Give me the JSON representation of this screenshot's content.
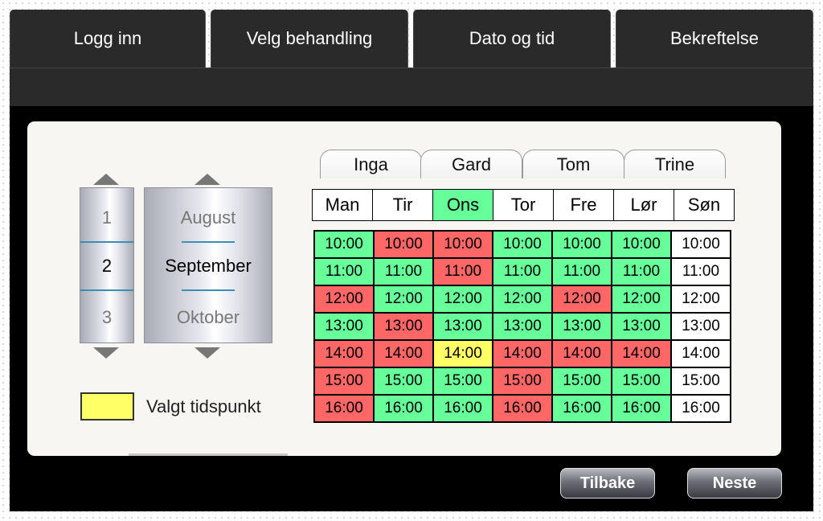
{
  "top_tabs": [
    "Logg inn",
    "Velg behandling",
    "Dato og tid",
    "Bekreftelse"
  ],
  "day_spinner": {
    "prev": "1",
    "current": "2",
    "next": "3"
  },
  "month_spinner": {
    "prev": "August",
    "current": "September",
    "next": "Oktober"
  },
  "legend": {
    "label": "Valgt tidspunkt",
    "color": "#ffff66"
  },
  "staff_tabs": [
    "Inga",
    "Gard",
    "Tom",
    "Trine"
  ],
  "days": [
    "Man",
    "Tir",
    "Ons",
    "Tor",
    "Fre",
    "Lør",
    "Søn"
  ],
  "active_day": 2,
  "times": [
    "10:00",
    "11:00",
    "12:00",
    "13:00",
    "14:00",
    "15:00",
    "16:00"
  ],
  "slot_status_legend": {
    "g": "available",
    "r": "booked",
    "y": "selected",
    "w": "none"
  },
  "slots": [
    [
      "g",
      "r",
      "r",
      "g",
      "g",
      "g",
      "w"
    ],
    [
      "g",
      "g",
      "r",
      "g",
      "g",
      "g",
      "w"
    ],
    [
      "r",
      "g",
      "g",
      "g",
      "r",
      "g",
      "w"
    ],
    [
      "g",
      "r",
      "g",
      "g",
      "g",
      "g",
      "w"
    ],
    [
      "r",
      "r",
      "y",
      "r",
      "r",
      "r",
      "w"
    ],
    [
      "r",
      "g",
      "g",
      "r",
      "g",
      "g",
      "w"
    ],
    [
      "r",
      "g",
      "g",
      "r",
      "g",
      "g",
      "w"
    ]
  ],
  "buttons": {
    "back": "Tilbake",
    "next": "Neste"
  },
  "colors": {
    "available": "#66ff99",
    "booked": "#ff6666",
    "selected": "#ffff66",
    "chrome": "#2a2a2a"
  }
}
